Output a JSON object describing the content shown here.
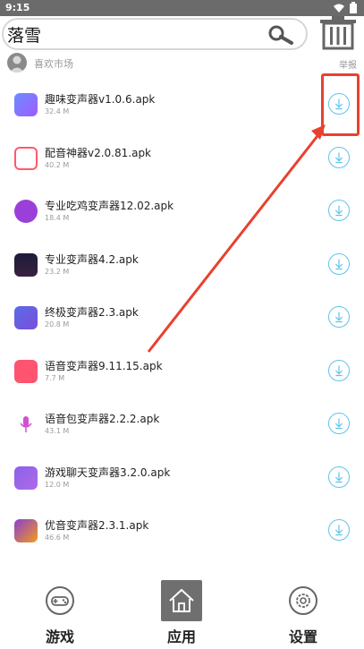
{
  "status": {
    "time": "9:15"
  },
  "search": {
    "value": "落雪"
  },
  "source": {
    "name": "喜欢市场",
    "report": "举报"
  },
  "apps": [
    {
      "name": "趣味变声器v1.0.6.apk",
      "size": "32.4 M",
      "icon": "funny-voice-changer-icon",
      "color": "#5a7bff"
    },
    {
      "name": "配音神器v2.0.81.apk",
      "size": "40.2 M",
      "icon": "dubbing-tool-icon",
      "color": "#ff5a6a"
    },
    {
      "name": "专业吃鸡变声器12.02.apk",
      "size": "18.4 M",
      "icon": "pubg-voice-changer-icon",
      "color": "#9b3fd9"
    },
    {
      "name": "专业变声器4.2.apk",
      "size": "23.2 M",
      "icon": "pro-voice-changer-icon",
      "color": "#1c1c3a"
    },
    {
      "name": "终极变声器2.3.apk",
      "size": "20.8 M",
      "icon": "ultimate-voice-changer-icon",
      "color": "#6a5be8"
    },
    {
      "name": "语音变声器9.11.15.apk",
      "size": "7.7 M",
      "icon": "voice-changer-icon",
      "color": "#ff5470"
    },
    {
      "name": "语音包变声器2.2.2.apk",
      "size": "43.1 M",
      "icon": "voice-pack-changer-icon",
      "color": "#d14fd1"
    },
    {
      "name": "游戏聊天变声器3.2.0.apk",
      "size": "12.0 M",
      "icon": "game-chat-voice-changer-icon",
      "color": "#8a62e8"
    },
    {
      "name": "优音变声器2.3.1.apk",
      "size": "46.6 M",
      "icon": "youyin-voice-changer-icon",
      "color": "#f29a1e"
    }
  ],
  "nav": {
    "games": "游戏",
    "apps": "应用",
    "settings": "设置"
  },
  "colors": {
    "accent": "#5ec3ec",
    "annotation": "#e8412f"
  }
}
